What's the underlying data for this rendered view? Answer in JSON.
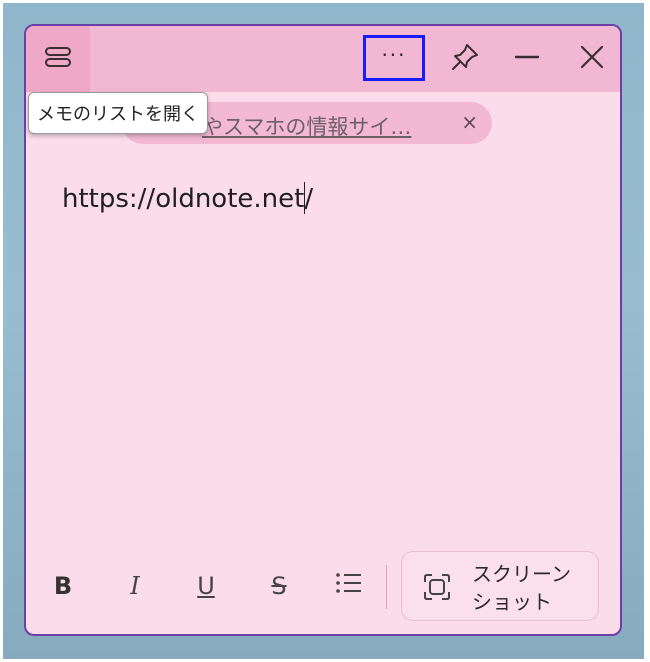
{
  "tooltip": {
    "text": "メモのリストを開く"
  },
  "titlebar": {
    "more_label": "···"
  },
  "tag": {
    "text": "やスマホの情報サイ…",
    "close_glyph": "×"
  },
  "note": {
    "content": "https://oldnote.net/"
  },
  "toolbar": {
    "bold": "B",
    "italic": "I",
    "underline": "U",
    "strike": "S",
    "screenshot_label": "スクリーンショット"
  },
  "icons": {
    "menu": "hamburger-icon",
    "pin": "pin-icon",
    "minimize": "minimize-icon",
    "close": "close-icon",
    "list": "bullet-list-icon",
    "screenshot": "screenshot-icon"
  },
  "colors": {
    "window_bg": "#fbdcea",
    "titlebar_bg": "#f2b8d3",
    "highlight_border": "#1a1aff",
    "window_border": "#6b3fa6"
  }
}
